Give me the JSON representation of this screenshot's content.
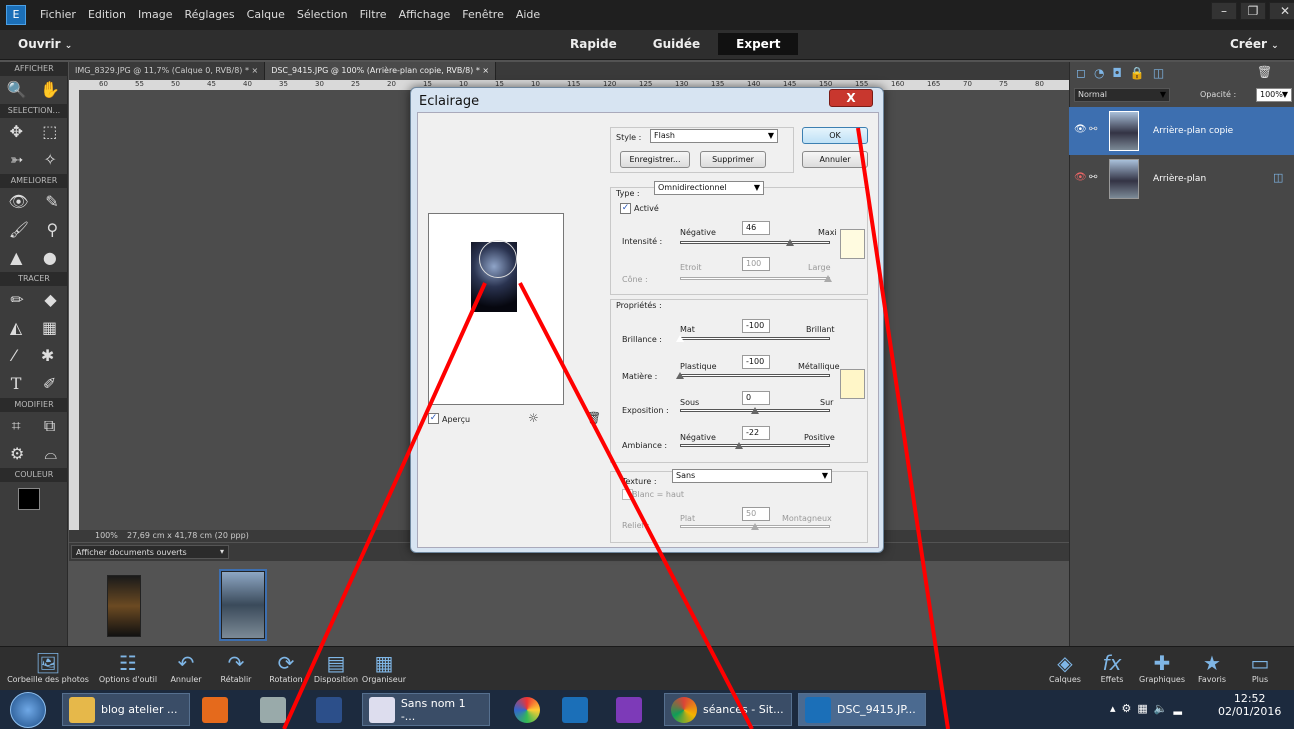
{
  "menubar": {
    "items": [
      "Fichier",
      "Edition",
      "Image",
      "Réglages",
      "Calque",
      "Sélection",
      "Filtre",
      "Affichage",
      "Fenêtre",
      "Aide"
    ]
  },
  "topbar": {
    "open_label": "Ouvrir",
    "modes": [
      "Rapide",
      "Guidée",
      "Expert"
    ],
    "active_mode": "Expert",
    "create_label": "Créer"
  },
  "tools": {
    "sections": [
      "AFFICHER",
      "SELECTION...",
      "AMELIORER",
      "TRACER",
      "MODIFIER",
      "COULEUR"
    ]
  },
  "doc_tabs": [
    {
      "label": "IMG_8329.JPG @ 11,7% (Calque 0, RVB/8) * ×"
    },
    {
      "label": "DSC_9415.JPG @ 100% (Arrière-plan copie, RVB/8) * ×"
    }
  ],
  "ruler_ticks": [
    "60",
    "55",
    "50",
    "45",
    "40",
    "35",
    "30",
    "25",
    "20",
    "15",
    "10",
    "15",
    "10",
    "115",
    "120",
    "125",
    "130",
    "135",
    "140",
    "145",
    "150",
    "155",
    "160",
    "165",
    "70",
    "75",
    "80",
    "85"
  ],
  "status": {
    "zoom": "100%",
    "size": "27,69 cm x 41,78 cm (20 ppp)"
  },
  "bin": {
    "dropdown": "Afficher documents ouverts"
  },
  "layers_panel": {
    "blend_mode": "Normal",
    "opacity_label": "Opacité :",
    "opacity_value": "100%",
    "layers": [
      {
        "name": "Arrière-plan copie",
        "selected": true
      },
      {
        "name": "Arrière-plan",
        "selected": false
      }
    ]
  },
  "dialog": {
    "title": "Eclairage",
    "close": "X",
    "style_label": "Style :",
    "style_value": "Flash",
    "ok": "OK",
    "cancel": "Annuler",
    "save": "Enregistrer...",
    "delete": "Supprimer",
    "type_label": "Type :",
    "type_value": "Omnidirectionnel",
    "active_label": "Activé",
    "intensity_label": "Intensité :",
    "intensity_min": "Négative",
    "intensity_max": "Maxi",
    "intensity_value": "46",
    "cone_label": "Cône :",
    "cone_min": "Etroit",
    "cone_max": "Large",
    "cone_value": "100",
    "properties_label": "Propriétés :",
    "gloss_label": "Brillance :",
    "gloss_min": "Mat",
    "gloss_max": "Brillant",
    "gloss_value": "-100",
    "material_label": "Matière :",
    "material_min": "Plastique",
    "material_max": "Métallique",
    "material_value": "-100",
    "exposure_label": "Exposition :",
    "exposure_min": "Sous",
    "exposure_max": "Sur",
    "exposure_value": "0",
    "ambiance_label": "Ambiance :",
    "ambiance_min": "Négative",
    "ambiance_max": "Positive",
    "ambiance_value": "-22",
    "texture_label": "Texture :",
    "texture_value": "Sans",
    "white_high_label": "Blanc = haut",
    "relief_label": "Relief :",
    "relief_min": "Plat",
    "relief_max": "Montagneux",
    "relief_value": "50",
    "preview_label": "Aperçu"
  },
  "bottombar": {
    "items": [
      "Corbeille des photos",
      "Options d'outil",
      "Annuler",
      "Rétablir",
      "Rotation",
      "Disposition",
      "Organiseur"
    ],
    "right_items": [
      "Calques",
      "Effets",
      "Graphiques",
      "Favoris",
      "Plus"
    ]
  },
  "taskbar": {
    "items": [
      "blog atelier ...",
      "Sans nom 1 -...",
      "séances - Sit...",
      "DSC_9415.JP..."
    ],
    "time": "12:52",
    "date": "02/01/2016"
  },
  "colors": {
    "accent": "#3d6fb0",
    "annotation": "#ff0000",
    "swatch": "#fffbe0"
  }
}
